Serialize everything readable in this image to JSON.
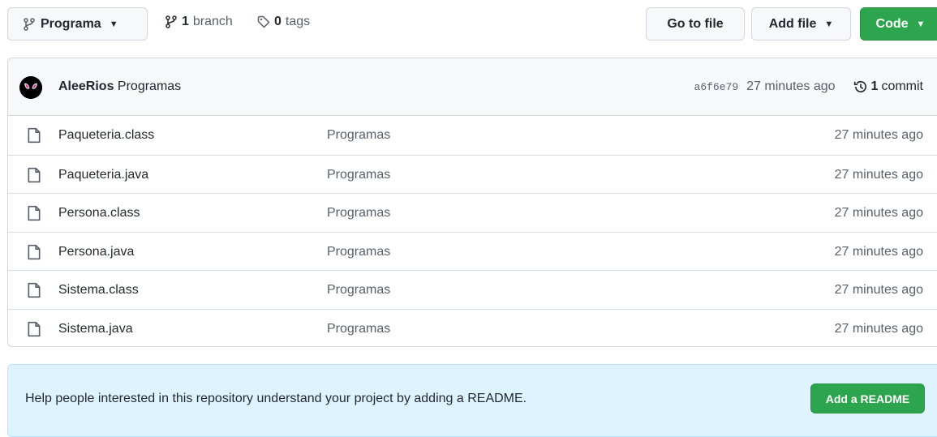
{
  "toolbar": {
    "branch_name": "Programa",
    "branch_count": "1",
    "branch_label": "branch",
    "tag_count": "0",
    "tag_label": "tags",
    "goto_label": "Go to file",
    "addfile_label": "Add file",
    "code_label": "Code"
  },
  "commit": {
    "author": "AleeRios",
    "message": "Programas",
    "sha": "a6f6e79",
    "time": "27 minutes ago",
    "count": "1",
    "count_label": "commit"
  },
  "files": [
    {
      "name": "Paqueteria.class",
      "message": "Programas",
      "time": "27 minutes ago"
    },
    {
      "name": "Paqueteria.java",
      "message": "Programas",
      "time": "27 minutes ago"
    },
    {
      "name": "Persona.class",
      "message": "Programas",
      "time": "27 minutes ago"
    },
    {
      "name": "Persona.java",
      "message": "Programas",
      "time": "27 minutes ago"
    },
    {
      "name": "Sistema.class",
      "message": "Programas",
      "time": "27 minutes ago"
    },
    {
      "name": "Sistema.java",
      "message": "Programas",
      "time": "27 minutes ago"
    }
  ],
  "readme": {
    "text": "Help people interested in this repository understand your project by adding a README.",
    "button": "Add a README"
  },
  "colors": {
    "primary_green": "#2da44e",
    "readme_bg": "#ddf4ff"
  }
}
